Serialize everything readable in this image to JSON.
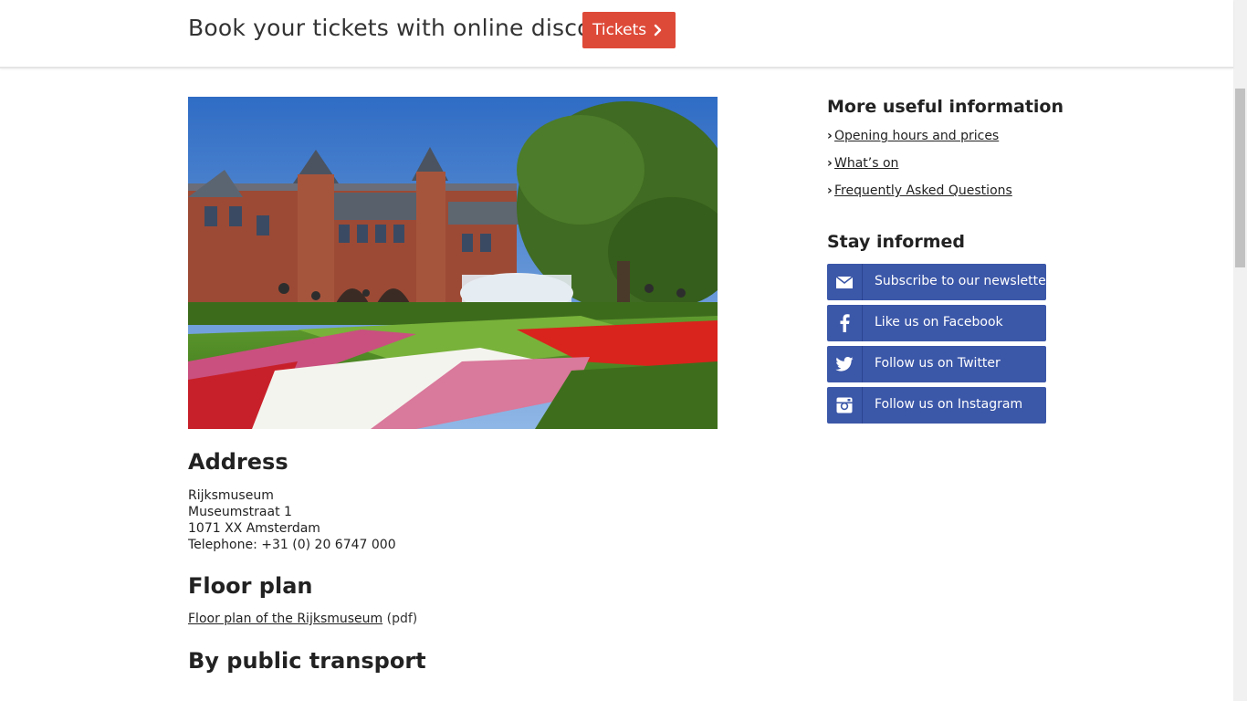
{
  "ticket_bar": {
    "text": "Book your tickets with online discount",
    "button_label": "Tickets"
  },
  "address": {
    "heading": "Address",
    "lines": [
      "Rijksmuseum",
      "Museumstraat 1",
      "1071 XX Amsterdam",
      "Telephone: +31 (0) 20 6747 000"
    ]
  },
  "floor_plan": {
    "heading": "Floor plan",
    "link": "Floor plan of the Rijksmuseum",
    "suffix": "(pdf)"
  },
  "transport": {
    "heading": "By public transport"
  },
  "sidebar": {
    "info_heading": "More useful information",
    "info_links": [
      "Opening hours and prices",
      "What’s on",
      "Frequently Asked Questions"
    ],
    "stay_heading": "Stay informed",
    "social": [
      {
        "label": "Subscribe to our newsletter",
        "icon": "envelope-icon"
      },
      {
        "label": "Like us on Facebook",
        "icon": "facebook-icon"
      },
      {
        "label": "Follow us on Twitter",
        "icon": "twitter-icon"
      },
      {
        "label": "Follow us on Instagram",
        "icon": "instagram-icon"
      }
    ]
  },
  "colors": {
    "ticket_button": "#de4a38",
    "social_button": "#3b57a8"
  }
}
